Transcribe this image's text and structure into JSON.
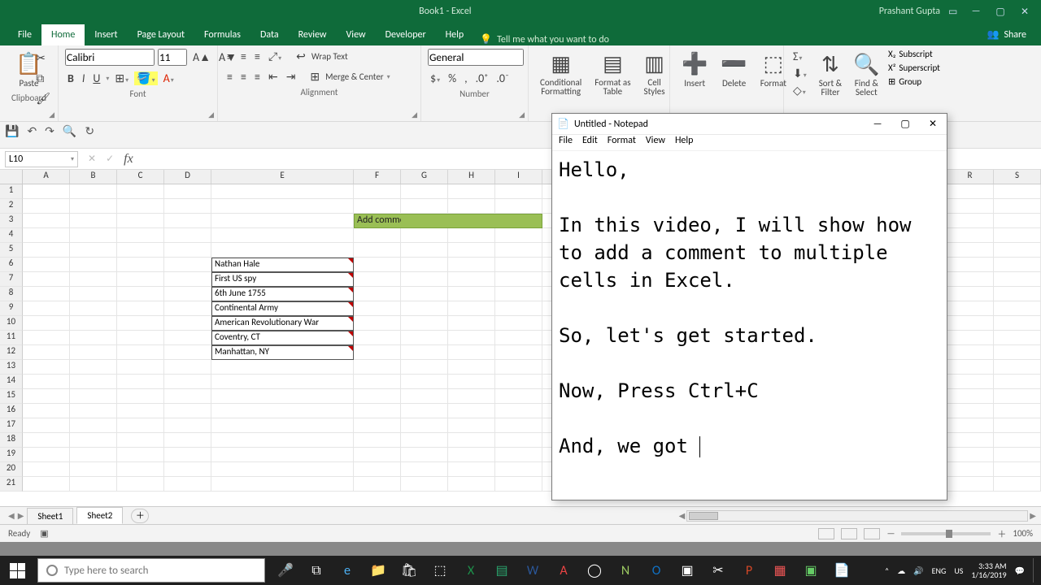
{
  "colors": {
    "accent": "#0f6b3a",
    "green_fill": "#9abf55"
  },
  "app": {
    "title": "Book1 - Excel",
    "user": "Prashant Gupta"
  },
  "tabs": {
    "items": [
      "File",
      "Home",
      "Insert",
      "Page Layout",
      "Formulas",
      "Data",
      "Review",
      "View",
      "Developer",
      "Help"
    ],
    "active": "Home",
    "tellme": "Tell me what you want to do",
    "share": "Share"
  },
  "ribbon": {
    "clipboard": {
      "paste": "Paste",
      "label": "Clipboard"
    },
    "font": {
      "name": "Calibri",
      "size": "11",
      "label": "Font"
    },
    "alignment": {
      "wrap": "Wrap Text",
      "merge": "Merge & Center",
      "label": "Alignment"
    },
    "number": {
      "format": "General",
      "label": "Number"
    },
    "styles": {
      "cond": "Conditional\nFormatting",
      "table": "Format as\nTable",
      "cell": "Cell\nStyles"
    },
    "cells": {
      "insert": "Insert",
      "delete": "Delete",
      "format": "Format"
    },
    "editing": {
      "sort": "Sort &\nFilter",
      "find": "Find &\nSelect"
    },
    "extra": {
      "sub": "Subscript",
      "sup": "Superscript",
      "group": "Group"
    }
  },
  "cellref": "L10",
  "columns": [
    "A",
    "B",
    "C",
    "D",
    "E",
    "F",
    "G",
    "H",
    "I"
  ],
  "columns_right": [
    "R",
    "S"
  ],
  "rows_visible": 21,
  "sheet_data": {
    "banner_cell": "F3:I3",
    "banner_text": "Add comment to multiple",
    "e_values": [
      "Nathan Hale",
      "First US spy",
      "6th June 1755",
      "Continental Army",
      "American Revolutionary War",
      "Coventry, CT",
      "Manhattan, NY"
    ],
    "e_start_row": 6
  },
  "sheetbar": {
    "tabs": [
      "Sheet1",
      "Sheet2"
    ],
    "active": "Sheet2"
  },
  "status": {
    "ready": "Ready",
    "zoom": "100%"
  },
  "notepad": {
    "title": "Untitled - Notepad",
    "menu": [
      "File",
      "Edit",
      "Format",
      "View",
      "Help"
    ],
    "lines": [
      "Hello,",
      "",
      "In this video, I will show how to add a comment to multiple cells in Excel.",
      "",
      "So, let's get started.",
      "",
      "Now, Press Ctrl+C ",
      "",
      "And, we got "
    ]
  },
  "taskbar": {
    "search_placeholder": "Type here to search",
    "tray": {
      "lang1": "ENG",
      "lang2": "US",
      "time": "3:33 AM",
      "date": "1/16/2019"
    }
  }
}
